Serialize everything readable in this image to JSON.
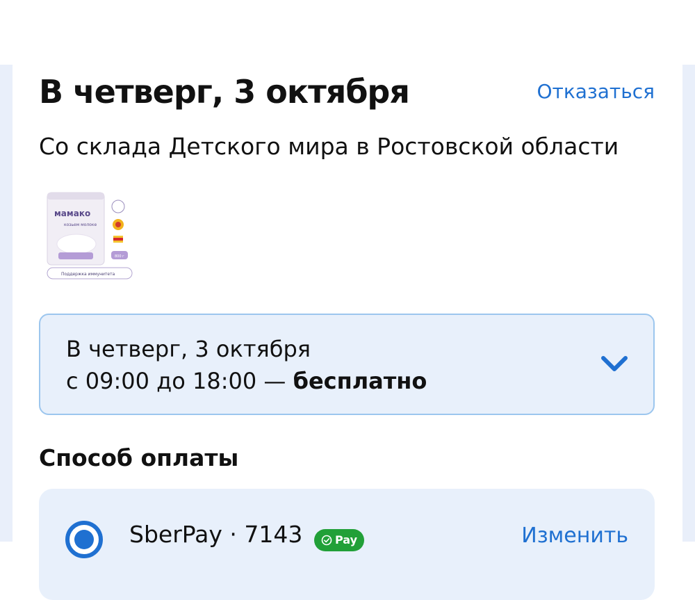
{
  "delivery": {
    "title": "В четверг, 3 октября",
    "cancel_label": "Отказаться",
    "warehouse": "Со склада Детского мира в Ростовской области",
    "product": {
      "brand": "мамако",
      "product_name": "козьем молоке",
      "weight": "800 г",
      "badge": "Поддержка иммунитета"
    },
    "slot": {
      "date": "В четверг, 3 октября",
      "time": "с 09:00 до 18:00 — ",
      "price": "бесплатно"
    }
  },
  "payment": {
    "title": "Способ оплаты",
    "method": "SberPay · 7143",
    "badge": "Pay",
    "change_label": "Изменить"
  },
  "colors": {
    "accent": "#1f70d1",
    "slot_bg": "#e8f0fb",
    "slot_border": "#9cc6ee",
    "sber_green": "#21a038"
  }
}
